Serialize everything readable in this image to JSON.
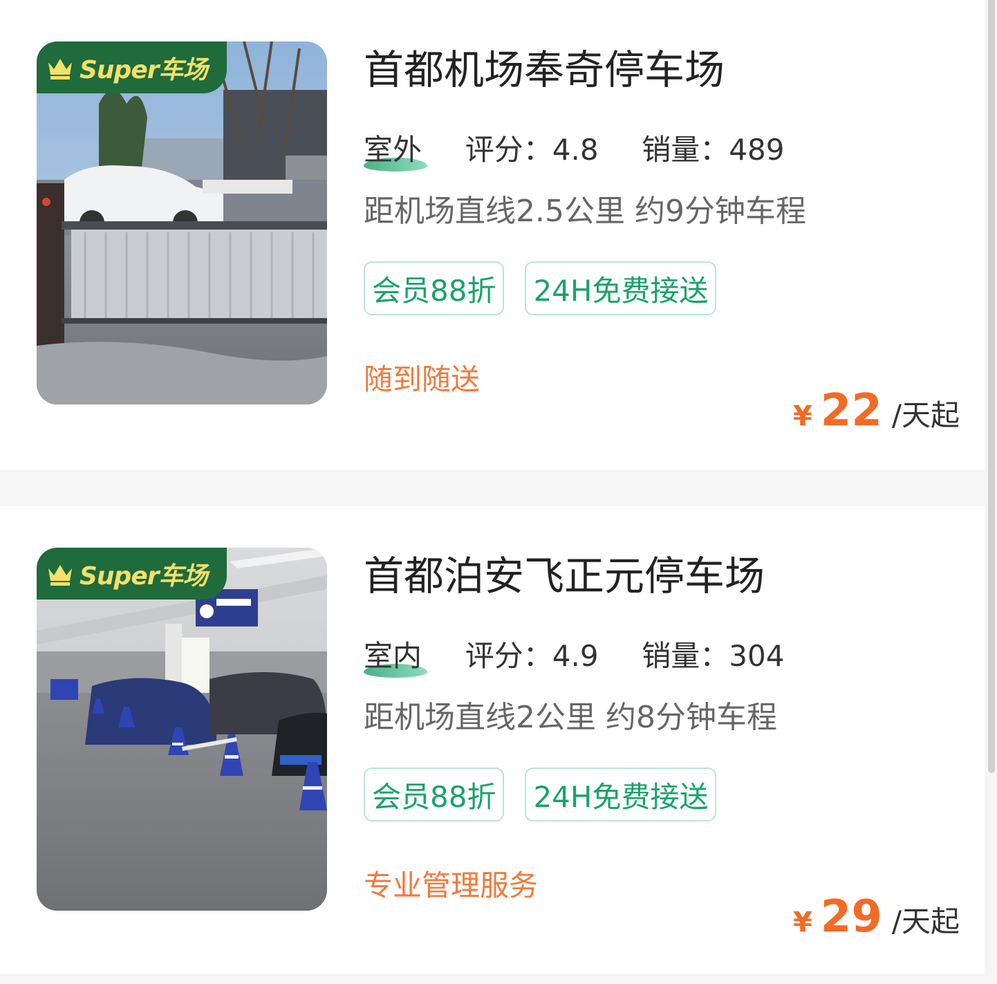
{
  "colors": {
    "page_bg": "#f5f5f5",
    "card_bg": "#ffffff",
    "badge_bg": "#1f6b3c",
    "badge_text": "#f4e06a",
    "tag_green": "#18a36a",
    "note_orange": "#f07a3c",
    "price_orange": "#f26b25"
  },
  "listings": [
    {
      "badge": "Super车场",
      "badge_icon": "crown-icon",
      "name": "首都机场奉奇停车场",
      "environment": "室外",
      "rating_label": "评分：",
      "rating": "4.8",
      "sales_label": "销量：",
      "sales": "489",
      "distance": "距机场直线2.5公里 约9分钟车程",
      "tags": [
        "会员88折",
        "24H免费接送"
      ],
      "note": "随到随送",
      "currency": "¥",
      "price": "22",
      "price_unit": "/天起"
    },
    {
      "badge": "Super车场",
      "badge_icon": "crown-icon",
      "name": "首都泊安飞正元停车场",
      "environment": "室内",
      "rating_label": "评分：",
      "rating": "4.9",
      "sales_label": "销量：",
      "sales": "304",
      "distance": "距机场直线2公里 约8分钟车程",
      "tags": [
        "会员88折",
        "24H免费接送"
      ],
      "note": "专业管理服务",
      "currency": "¥",
      "price": "29",
      "price_unit": "/天起"
    }
  ]
}
